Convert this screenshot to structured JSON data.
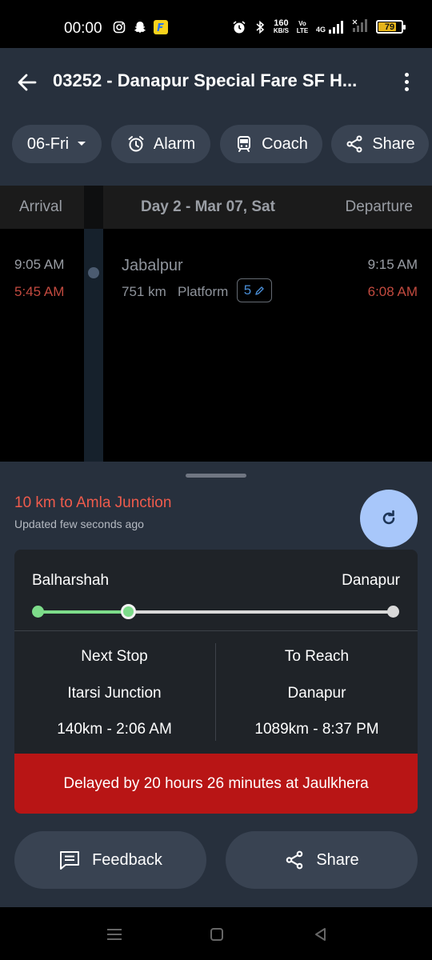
{
  "status_bar": {
    "time": "00:00",
    "speed_value": "160",
    "speed_unit": "KB/S",
    "volte": "Vo LTE",
    "network": "4G",
    "battery": "79",
    "battery_level": 0.79
  },
  "header": {
    "title": "03252 - Danapur Special Fare SF H..."
  },
  "chips": {
    "date": "06-Fri",
    "alarm": "Alarm",
    "coach": "Coach",
    "share": "Share"
  },
  "table": {
    "arrival_header": "Arrival",
    "day_header": "Day 2 - Mar 07, Sat",
    "departure_header": "Departure"
  },
  "stop": {
    "scheduled_arrival": "9:05 AM",
    "actual_arrival": "5:45 AM",
    "station": "Jabalpur",
    "distance": "751 km",
    "platform_label": "Platform",
    "platform_number": "5",
    "scheduled_departure": "9:15 AM",
    "actual_departure": "6:08 AM"
  },
  "status": {
    "distance_text": "10 km to Amla Junction",
    "updated_text": "Updated few seconds ago"
  },
  "journey": {
    "from": "Balharshah",
    "to": "Danapur",
    "next_stop_label": "Next Stop",
    "next_stop_station": "Itarsi Junction",
    "next_stop_eta": "140km - 2:06 AM",
    "to_reach_label": "To Reach",
    "to_reach_station": "Danapur",
    "to_reach_eta": "1089km - 8:37 PM",
    "delay_text": "Delayed by 20 hours 26 minutes at Jaulkhera"
  },
  "actions": {
    "feedback": "Feedback",
    "share": "Share"
  },
  "colors": {
    "header_bg": "#27303d",
    "chip_bg": "#394352",
    "progress_done": "#7ddc8a",
    "delay_red": "#b81515",
    "alert_text": "#ef5b4c",
    "refresh_fab": "#a8c7fa"
  }
}
